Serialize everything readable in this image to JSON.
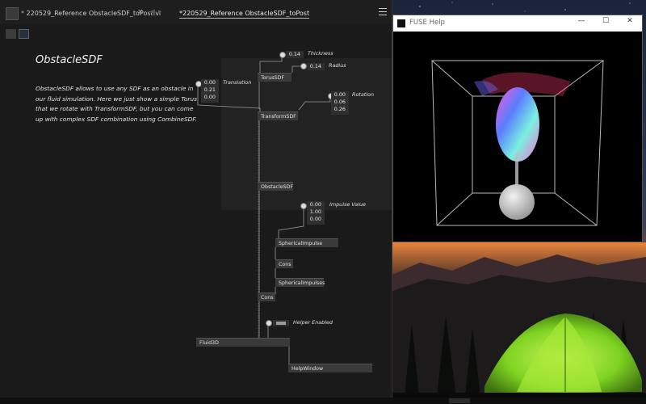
{
  "editor": {
    "tab1": {
      "marker": "*",
      "label": "220529_Reference ObstacleSDF_toPost.vl",
      "close": "×"
    },
    "nav": {
      "back": "◀",
      "forward": "▸"
    },
    "tab2": {
      "label": "*220529_Reference ObstacleSDF_toPost"
    },
    "doc": {
      "title": "ObstacleSDF",
      "body": "ObstacleSDF allows to use any SDF as an obstacle in our fluid simulation. Here we just show a simple Torus that we rotate with TransformSDF, but you can come up with complex SDF combination using CombineSDF."
    },
    "values": {
      "thickness": "0.14",
      "radius": "0.14",
      "translation": [
        "0.00",
        "0.21",
        "0.00"
      ],
      "rotation": [
        "0.00",
        "0.06",
        "0.26"
      ],
      "impulse": [
        "0.00",
        "1.00",
        "0.00"
      ]
    },
    "labels": {
      "thickness": "Thickness",
      "radius": "Radius",
      "translation": "Translation",
      "rotation": "Rotation",
      "impulse": "Impulse Value",
      "helper": "Helper Enabled"
    },
    "nodes": {
      "torus": "TorusSDF",
      "transform": "TransformSDF",
      "obstacle": "ObstacleSDF",
      "spherical_impulse": "SphericalImpulse",
      "cons1": "Cons",
      "spherical_impulses": "SphericalImpulses",
      "cons2": "Cons",
      "fluid": "Fluid3D",
      "help_window": "HelpWindow"
    }
  },
  "help_window": {
    "title": "FUSE Help",
    "minimize": "—",
    "maximize": "☐",
    "close": "✕"
  },
  "colors": {
    "editor_bg": "#1a1a1a",
    "node_bg": "#3a3a3a",
    "wire": "#9a9a9a",
    "tent": "#7ed321"
  }
}
